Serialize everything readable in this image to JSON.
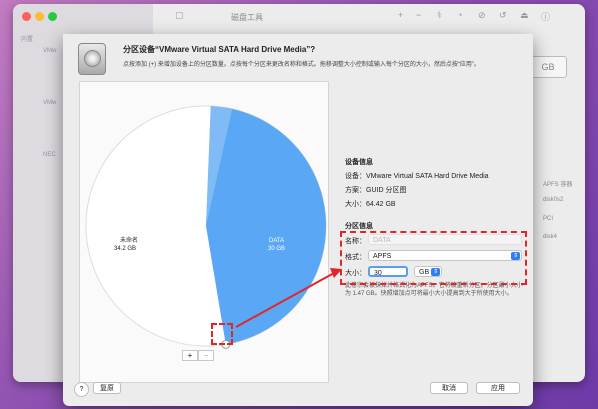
{
  "window": {
    "title": "磁盘工具",
    "sidebar": {
      "section": "内置",
      "items": [
        "VMw",
        "VMw",
        "NEC"
      ]
    },
    "bg_right": {
      "gb": "GB",
      "labels": [
        "APFS 容器",
        "disk0s2",
        "PCI",
        "disk4"
      ]
    }
  },
  "sheet": {
    "title": "分区设备“VMware Virtual SATA Hard Drive Media”?",
    "description": "点按添加 (+) 来增加设备上的分区数量。点按每个分区来更改名称和格式。拖移调整大小控制或输入每个分区的大小，然后点按“应用”。"
  },
  "pie": {
    "slices": [
      {
        "name": "未命名",
        "size_text": "34.2 GB",
        "value": 34.2,
        "color": "#ffffff"
      },
      {
        "name": "DATA",
        "size_text": "30 GB",
        "value": 30,
        "color": "#5aa8f5"
      }
    ],
    "add_button": "+",
    "remove_button": "−"
  },
  "device_info": {
    "heading": "设备信息",
    "device_label": "设备：",
    "device_value": "VMware Virtual SATA Hard Drive Media",
    "scheme_label": "方案：",
    "scheme_value": "GUID 分区图",
    "size_label": "大小：",
    "size_value": "64.42 GB"
  },
  "partition_info": {
    "heading": "分区信息",
    "name_label": "名称：",
    "name_value": "DATA",
    "format_label": "格式：",
    "format_value": "APFS",
    "size_label": "大小：",
    "size_value": "30",
    "unit_value": "GB",
    "hint": "此卷宗会被抹掉并格式化为APFS。它将被重新分区。分区最小大小为 1.47 GB。快照增加点可将最小大小提高到大于所使用大小。"
  },
  "buttons": {
    "help": "?",
    "revert": "复原",
    "cancel": "取消",
    "apply": "应用"
  },
  "colors": {
    "accent": "#2f7ef6",
    "annotation": "#e0262b",
    "pie_blue": "#5aa8f5"
  }
}
